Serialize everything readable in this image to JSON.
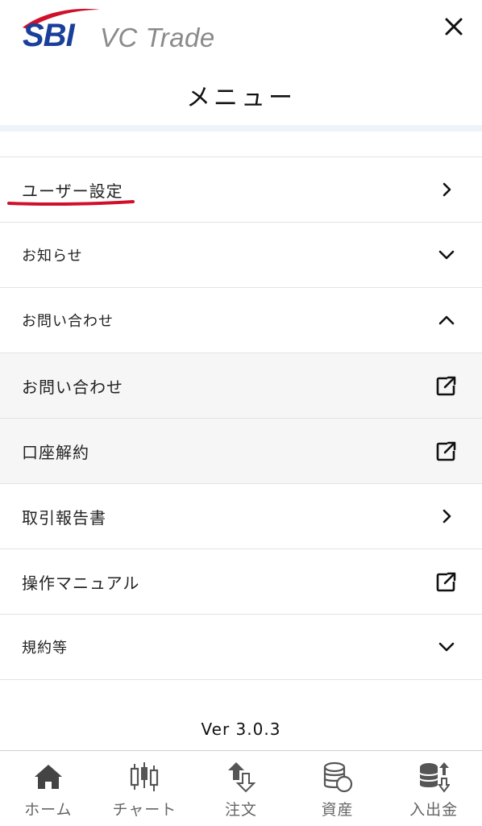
{
  "header": {
    "logo_brand": "SBI",
    "logo_product": "VC Trade",
    "title": "メニュー"
  },
  "menu": {
    "items": [
      {
        "label": "ユーザー設定",
        "icon": "chevron-right-icon"
      },
      {
        "label": "お知らせ",
        "icon": "chevron-down-icon"
      },
      {
        "label": "お問い合わせ",
        "icon": "chevron-up-icon"
      },
      {
        "label": "お問い合わせ",
        "icon": "external-link-icon"
      },
      {
        "label": "口座解約",
        "icon": "external-link-icon"
      },
      {
        "label": "取引報告書",
        "icon": "chevron-right-icon"
      },
      {
        "label": "操作マニュアル",
        "icon": "external-link-icon"
      },
      {
        "label": "規約等",
        "icon": "chevron-down-icon"
      }
    ]
  },
  "version": "Ver 3.0.3",
  "tabbar": {
    "tabs": [
      {
        "label": "ホーム",
        "icon": "home-icon"
      },
      {
        "label": "チャート",
        "icon": "candlestick-chart-icon"
      },
      {
        "label": "注文",
        "icon": "order-arrows-icon"
      },
      {
        "label": "資産",
        "icon": "coin-stack-icon"
      },
      {
        "label": "入出金",
        "icon": "deposit-withdraw-icon"
      }
    ]
  },
  "colors": {
    "brand_blue": "#1a3f9a",
    "brand_red": "#d0102b",
    "highlight_underline": "#d0102b",
    "submenu_bg": "#f6f6f6",
    "header_band": "#eef3fb"
  }
}
